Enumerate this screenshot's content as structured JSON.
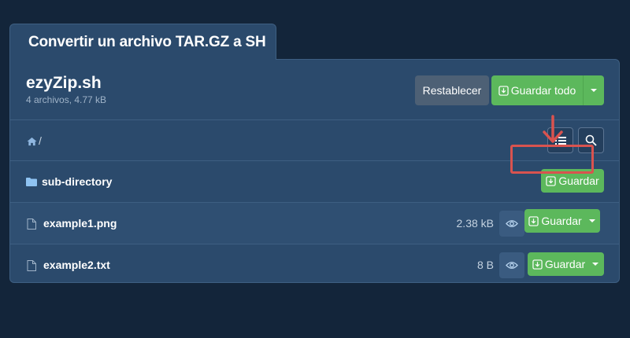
{
  "page": {
    "tab_title": "Convertir un archivo TAR.GZ a SH"
  },
  "archive": {
    "name": "ezyZip.sh",
    "meta": "4 archivos, 4.77 kB",
    "reset_label": "Restablecer",
    "save_all_label": "Guardar todo"
  },
  "breadcrumb": {
    "separator": "/"
  },
  "icons": {
    "home": "home-icon",
    "list": "list-icon",
    "search": "search-icon",
    "folder": "folder-icon",
    "file": "file-icon",
    "eye": "eye-icon",
    "download": "download-icon",
    "caret": "caret-down-icon"
  },
  "rows": [
    {
      "name": "sub-directory",
      "type": "folder",
      "size": "",
      "save_label": "Guardar"
    },
    {
      "name": "example1.png",
      "type": "file",
      "size": "2.38 kB",
      "save_label": "Guardar"
    },
    {
      "name": "example2.txt",
      "type": "file",
      "size": "8 B",
      "save_label": "Guardar"
    }
  ],
  "colors": {
    "background": "#13253a",
    "panel": "#2b4a6c",
    "green": "#5cb85c",
    "gray_button": "#4d6075",
    "highlight": "#d9534f"
  }
}
